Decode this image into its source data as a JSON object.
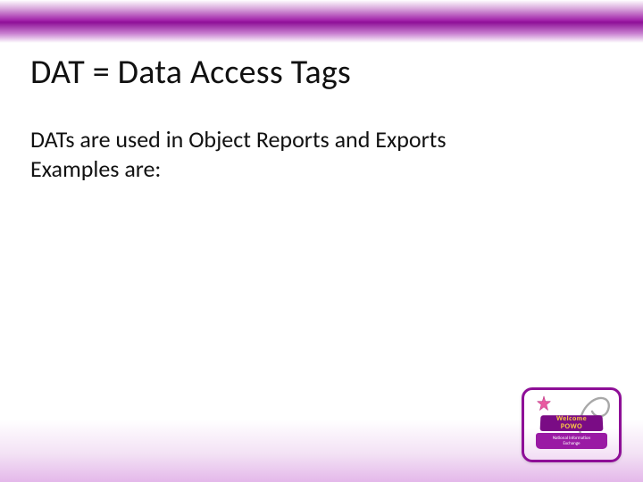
{
  "title": "DAT = Data Access Tags",
  "body": {
    "line1": "DATs are used in Object Reports and Exports",
    "line2": "Examples are:"
  },
  "logo": {
    "sign_line1": "Welcome",
    "sign_line2": "POWO",
    "banner_line1": "National Information",
    "banner_line2": "Exchange"
  },
  "colors": {
    "accent": "#8e0f97"
  }
}
